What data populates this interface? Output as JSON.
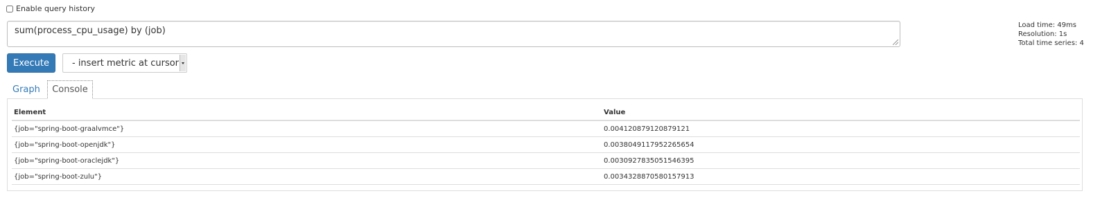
{
  "query_history": {
    "label": "Enable query history",
    "checked": false
  },
  "expression": {
    "value": "sum(process_cpu_usage) by (job)"
  },
  "stats": {
    "load_time": "Load time: 49ms",
    "resolution": "Resolution: 1s",
    "total_series": "Total time series: 4"
  },
  "controls": {
    "execute_label": "Execute",
    "metric_select_value": "- insert metric at cursor"
  },
  "tabs": [
    {
      "label": "Graph",
      "active": false
    },
    {
      "label": "Console",
      "active": true
    }
  ],
  "table": {
    "headers": [
      "Element",
      "Value"
    ],
    "rows": [
      {
        "element": "{job=\"spring-boot-graalvmce\"}",
        "value": "0.004120879120879121"
      },
      {
        "element": "{job=\"spring-boot-openjdk\"}",
        "value": "0.0038049117952265654"
      },
      {
        "element": "{job=\"spring-boot-oraclejdk\"}",
        "value": "0.0030927835051546395"
      },
      {
        "element": "{job=\"spring-boot-zulu\"}",
        "value": "0.0034328870580157913"
      }
    ]
  },
  "colors": {
    "primary": "#337ab7",
    "border": "#dddddd",
    "text": "#333333"
  }
}
